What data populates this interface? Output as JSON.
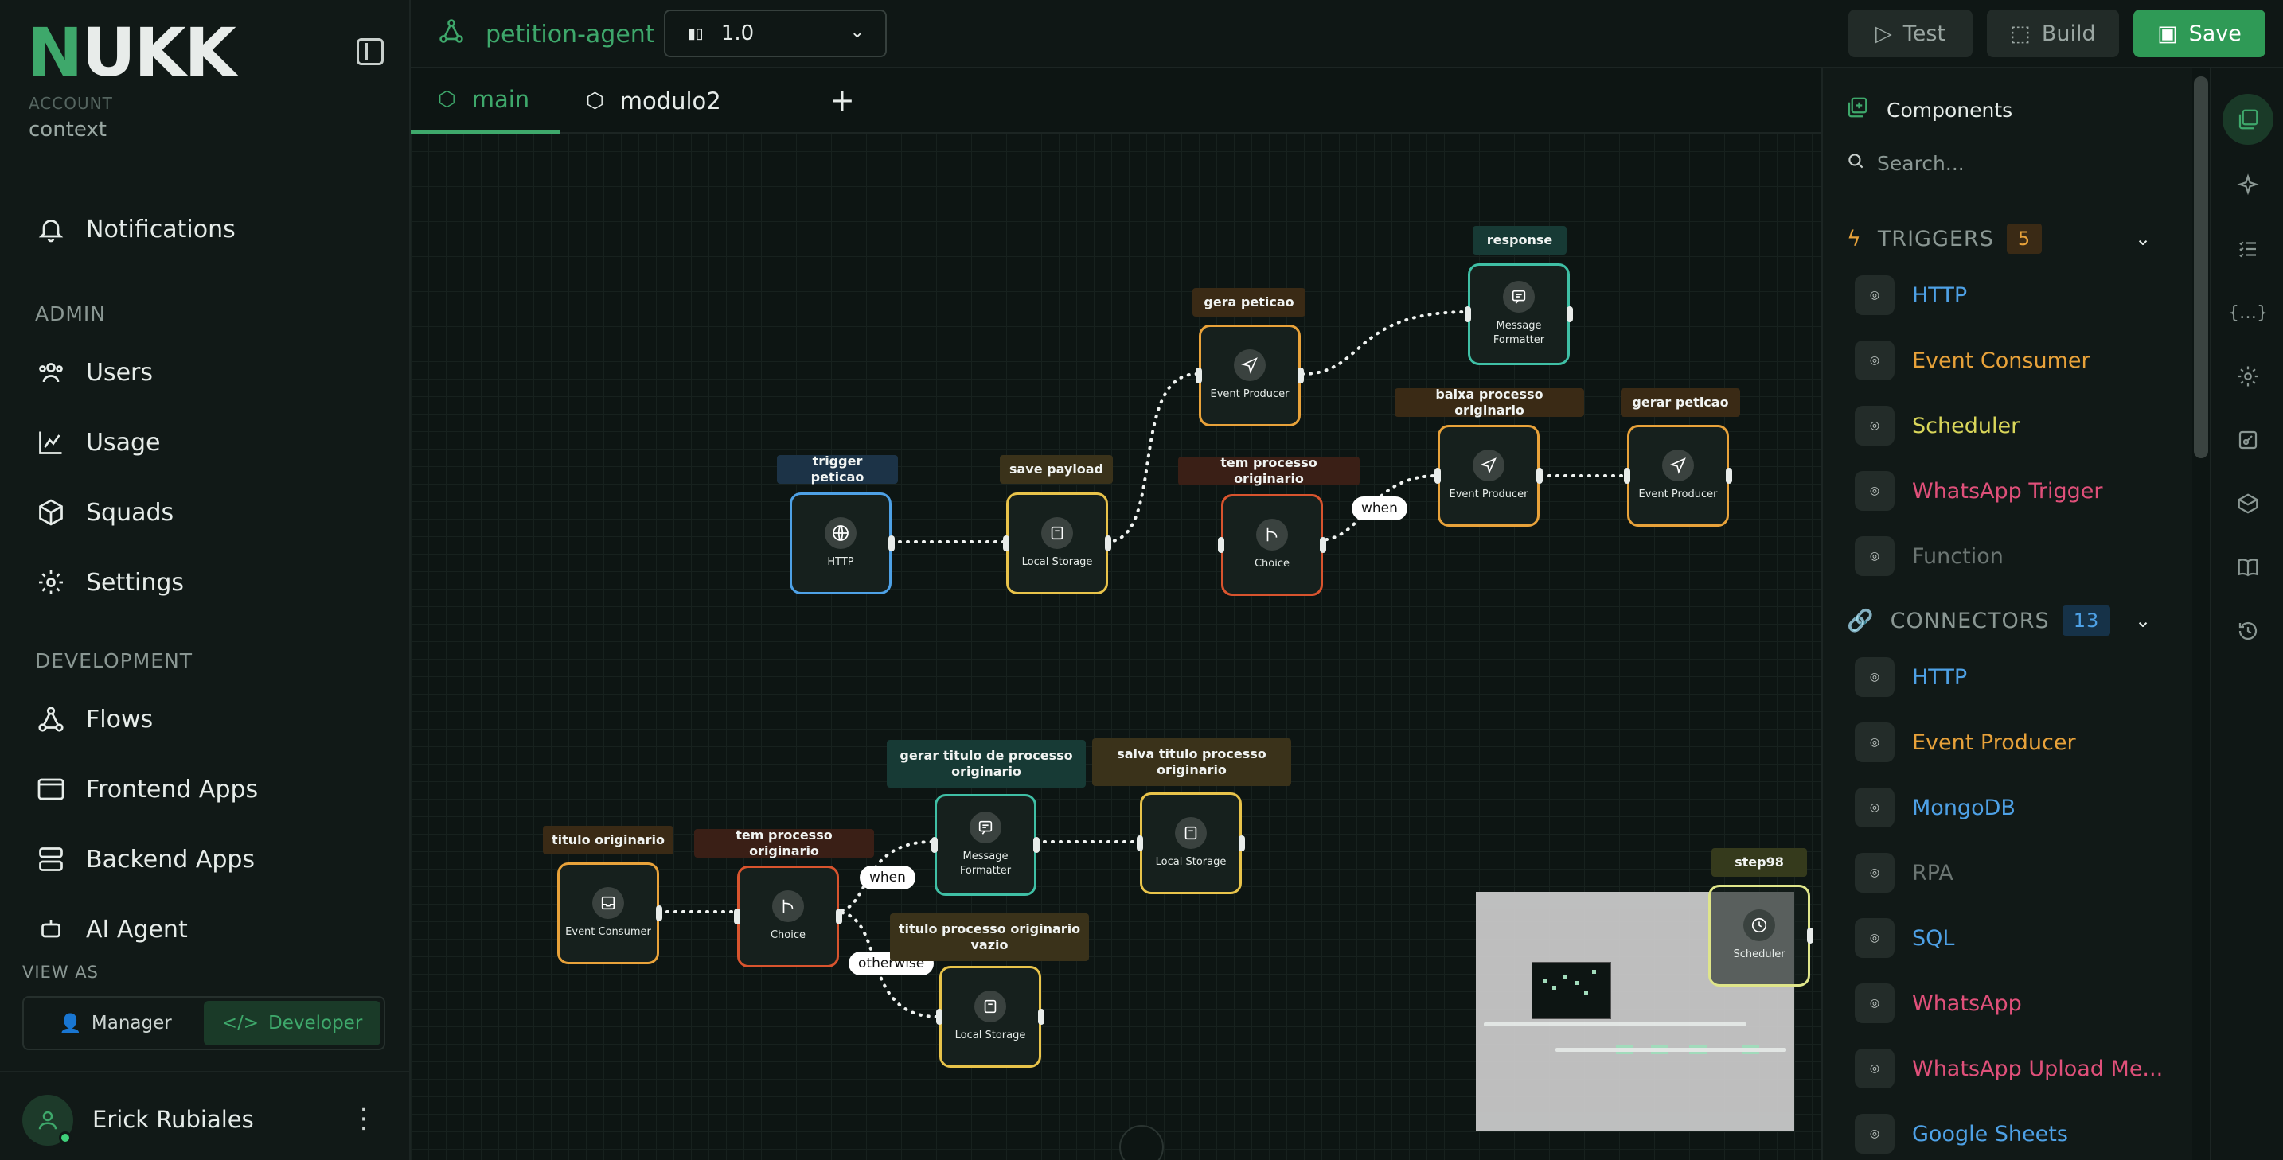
{
  "sidebar": {
    "logo": "NUKK",
    "account_label": "ACCOUNT",
    "account_value": "context",
    "notifications": "Notifications",
    "admin_header": "ADMIN",
    "admin_items": [
      "Users",
      "Usage",
      "Squads",
      "Settings"
    ],
    "dev_header": "DEVELOPMENT",
    "dev_items": [
      "Flows",
      "Frontend Apps",
      "Backend Apps",
      "AI Agent"
    ],
    "view_as": "VIEW AS",
    "view_manager": "Manager",
    "view_developer": "Developer",
    "user_name": "Erick Rubiales"
  },
  "header": {
    "project": "petition-agent",
    "version": "1.0",
    "test": "Test",
    "build": "Build",
    "save": "Save"
  },
  "tabs": [
    "main",
    "modulo2"
  ],
  "canvas": {
    "tags": {
      "trigger": "trigger peticao",
      "save_payload": "save payload",
      "gera_peticao": "gera peticao",
      "response": "response",
      "tem_processo_1": "tem processo originario",
      "baixa": "baixa processo originario",
      "gerar_peticao": "gerar peticao",
      "gerar_titulo": "gerar titulo de processo originario",
      "salva_titulo": "salva titulo processo originario",
      "titulo_originario": "titulo originario",
      "tem_processo_2": "tem processo originario",
      "titulo_vazio": "titulo processo originario vazio",
      "step98": "step98"
    },
    "nodes": {
      "http": "HTTP",
      "local_storage": "Local Storage",
      "event_producer": "Event Producer",
      "message_formatter": "Message Formatter",
      "choice": "Choice",
      "event_consumer": "Event Consumer",
      "scheduler": "Scheduler"
    },
    "pills": {
      "when": "when",
      "otherwise": "otherwise"
    }
  },
  "panel": {
    "title": "Components",
    "search_placeholder": "Search...",
    "triggers_label": "TRIGGERS",
    "triggers_count": "5",
    "triggers": [
      {
        "label": "HTTP",
        "color": "#4ea1e6"
      },
      {
        "label": "Event Consumer",
        "color": "#e8a23a"
      },
      {
        "label": "Scheduler",
        "color": "#d9d65a"
      },
      {
        "label": "WhatsApp Trigger",
        "color": "#e0507a"
      },
      {
        "label": "Function",
        "color": "#6b7572"
      }
    ],
    "connectors_label": "CONNECTORS",
    "connectors_count": "13",
    "connectors": [
      {
        "label": "HTTP",
        "color": "#4ea1e6"
      },
      {
        "label": "Event Producer",
        "color": "#e8a23a"
      },
      {
        "label": "MongoDB",
        "color": "#4ea1e6"
      },
      {
        "label": "RPA",
        "color": "#6b7572"
      },
      {
        "label": "SQL",
        "color": "#4ea1e6"
      },
      {
        "label": "WhatsApp",
        "color": "#e0507a"
      },
      {
        "label": "WhatsApp Upload Me...",
        "color": "#e0507a"
      },
      {
        "label": "Google Sheets",
        "color": "#4ea1e6"
      }
    ]
  },
  "colors": {
    "accent": "#3ea86b",
    "http": "#4ea1e6",
    "storage": "#e8c34a",
    "producer": "#e8a23a",
    "formatter": "#3fbfa5",
    "choice": "#d8542e",
    "scheduler": "#dfe58a"
  }
}
